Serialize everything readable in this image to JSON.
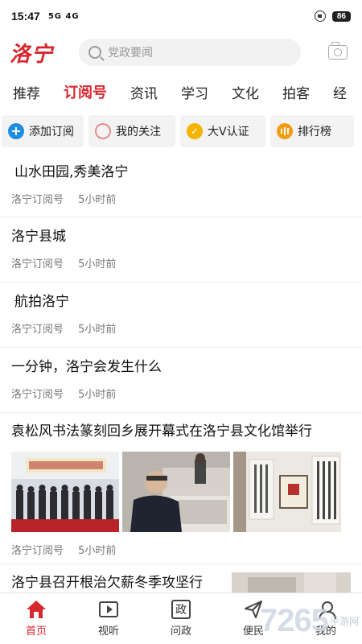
{
  "status_bar": {
    "time": "15:47",
    "signal": "5G 4G",
    "battery": "86"
  },
  "header": {
    "logo": "洛宁",
    "search_placeholder": "党政要闻"
  },
  "tabs": [
    "推荐",
    "订阅号",
    "资讯",
    "学习",
    "文化",
    "拍客",
    "经"
  ],
  "active_tab": "订阅号",
  "chips": [
    {
      "label": "添加订阅",
      "icon": "plus-icon"
    },
    {
      "label": "我的关注",
      "icon": "circle-icon"
    },
    {
      "label": "大V认证",
      "icon": "check-icon"
    },
    {
      "label": "排行榜",
      "icon": "rank-icon"
    }
  ],
  "feed": [
    {
      "title": "山水田园,秀美洛宁",
      "source": "洛宁订阅号",
      "time": "5小时前"
    },
    {
      "title": "洛宁县城",
      "source": "洛宁订阅号",
      "time": "5小时前"
    },
    {
      "title": "航拍洛宁",
      "source": "洛宁订阅号",
      "time": "5小时前"
    },
    {
      "title": "一分钟，洛宁会发生什么",
      "source": "洛宁订阅号",
      "time": "5小时前"
    },
    {
      "title": "袁松风书法篆刻回乡展开幕式在洛宁县文化馆举行",
      "source": "洛宁订阅号",
      "time": "5小时前"
    },
    {
      "title": "洛宁县召开根治欠薪冬季攻坚行"
    }
  ],
  "bottom_nav": [
    {
      "label": "首页",
      "icon": "home-icon"
    },
    {
      "label": "视听",
      "icon": "tv-icon"
    },
    {
      "label": "问政",
      "icon": "zheng-icon",
      "glyph": "政"
    },
    {
      "label": "便民",
      "icon": "send-icon"
    },
    {
      "label": "我的",
      "icon": "user-icon"
    }
  ],
  "watermark": {
    "big": "7265",
    "small": "手游网"
  },
  "colors": {
    "brand_red": "#d8262d",
    "blue": "#1d8de2",
    "gold": "#f5b400",
    "orange": "#f39c12"
  }
}
